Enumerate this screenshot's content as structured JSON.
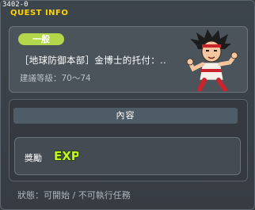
{
  "window": {
    "quest_id": "3402-0",
    "title": "QUEST INFO"
  },
  "quest": {
    "tag": "一般",
    "name": "［地球防御本部］金博士的托付：..",
    "level": "建議等級：70～74",
    "npc_icon": "npc-portrait-icon"
  },
  "content": {
    "section_title": "內容",
    "reward_label": "獎勵",
    "reward_icon": "exp-icon",
    "reward_icon_text": "EXP"
  },
  "footer": {
    "status": "狀態：可開始 / 不可執行任務"
  },
  "colors": {
    "title": "#ffd200",
    "tag_bg": "#b4d64a",
    "exp_fill": "#c6f21e",
    "exp_outline": "#1f3d0a"
  }
}
